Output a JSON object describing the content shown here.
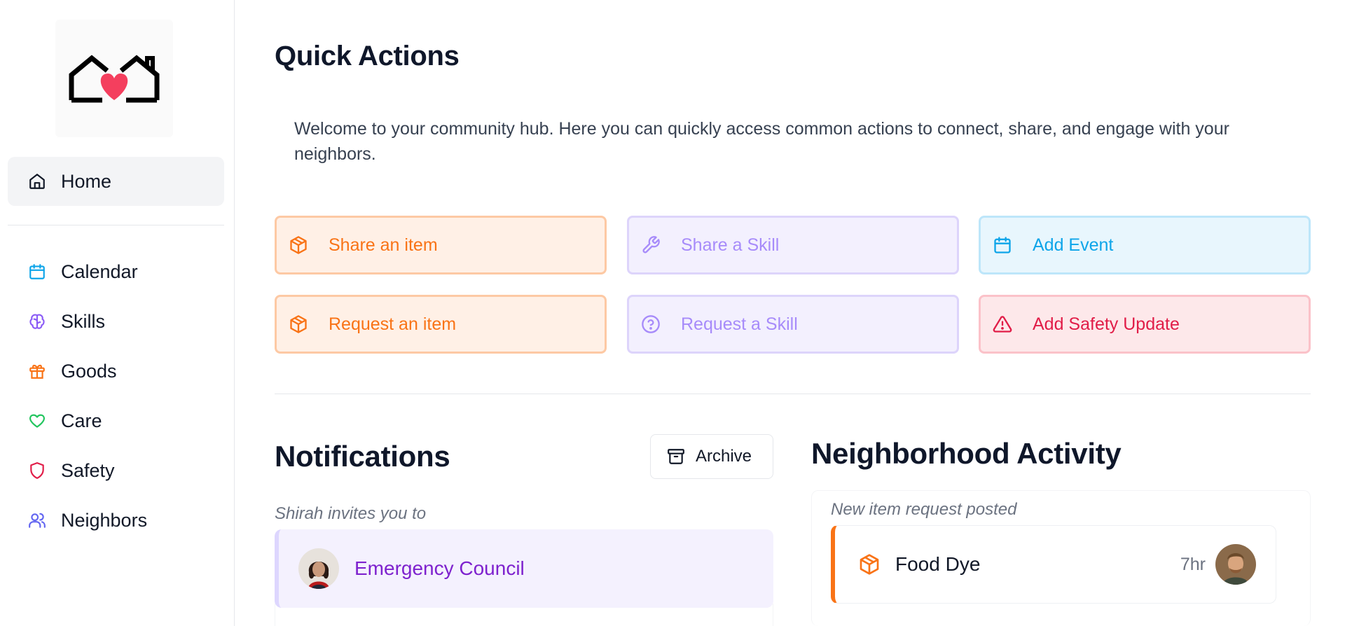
{
  "sidebar": {
    "items": [
      {
        "label": "Home",
        "icon": "home-icon"
      },
      {
        "label": "Calendar",
        "icon": "calendar-icon"
      },
      {
        "label": "Skills",
        "icon": "brain-icon"
      },
      {
        "label": "Goods",
        "icon": "gift-icon"
      },
      {
        "label": "Care",
        "icon": "heart-icon"
      },
      {
        "label": "Safety",
        "icon": "shield-icon"
      },
      {
        "label": "Neighbors",
        "icon": "users-icon"
      }
    ]
  },
  "quick_actions": {
    "title": "Quick Actions",
    "welcome": "Welcome to your community hub. Here you can quickly access common actions to connect, share, and engage with your neighbors.",
    "actions": [
      {
        "label": "Share an item",
        "icon": "package-icon",
        "color": "#f97316"
      },
      {
        "label": "Share a Skill",
        "icon": "wrench-icon",
        "color": "#a78bfa"
      },
      {
        "label": "Add Event",
        "icon": "calendar-icon",
        "color": "#0ea5e9"
      },
      {
        "label": "Request an item",
        "icon": "package-icon",
        "color": "#f97316"
      },
      {
        "label": "Request a Skill",
        "icon": "help-circle-icon",
        "color": "#a78bfa"
      },
      {
        "label": "Add Safety Update",
        "icon": "alert-triangle-icon",
        "color": "#e11d48"
      }
    ]
  },
  "notifications": {
    "title": "Notifications",
    "archive_label": "Archive",
    "invite_text": "Shirah invites you to",
    "item_title": "Emergency Council"
  },
  "activity": {
    "title": "Neighborhood Activity",
    "subtitle": "New item request posted",
    "item_title": "Food Dye",
    "item_time": "7hr"
  }
}
